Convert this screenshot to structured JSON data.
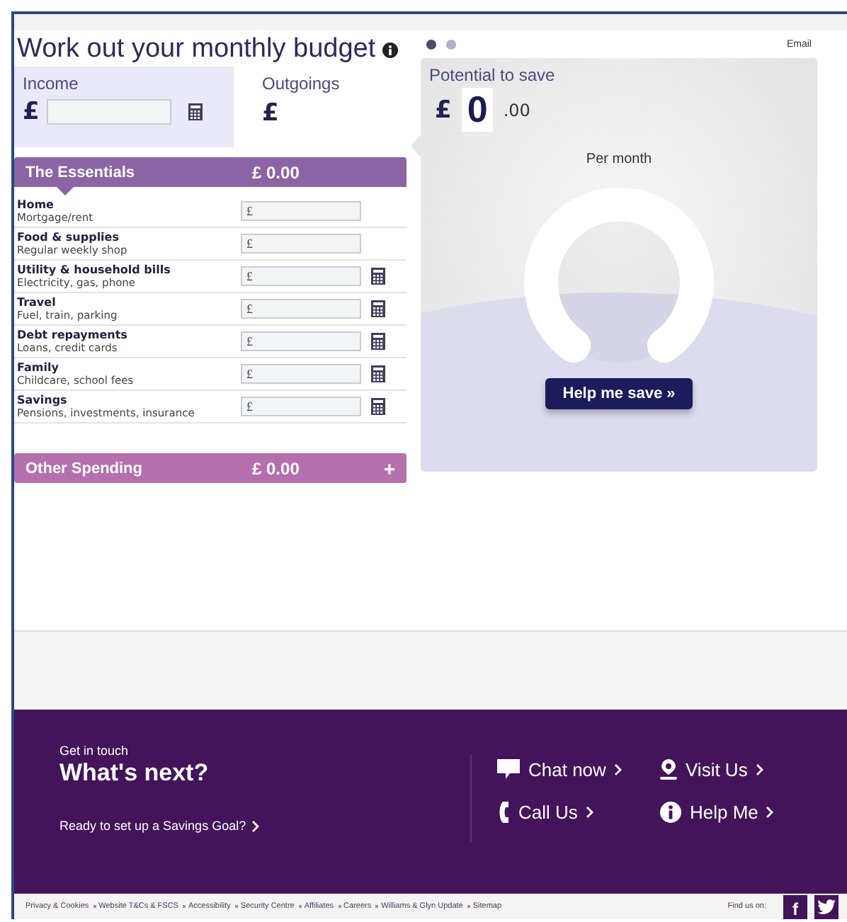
{
  "title": "Work out your monthly budget",
  "carousel": [
    {
      "selected": true
    },
    {
      "selected": false
    }
  ],
  "email_link": "Email",
  "income": {
    "label": "Income",
    "currency": "£"
  },
  "outgoings": {
    "label": "Outgoings",
    "currency": "£"
  },
  "essentials": {
    "title": "The Essentials",
    "total": "£ 0.00"
  },
  "rows": [
    {
      "name": "Home",
      "detail": "Mortgage/rent",
      "currency": "£",
      "calculator": false
    },
    {
      "name": "Food & supplies",
      "detail": "Regular weekly shop",
      "currency": "£",
      "calculator": false
    },
    {
      "name": "Utility & household bills",
      "detail": "Electricity, gas, phone",
      "currency": "£",
      "calculator": true
    },
    {
      "name": "Travel",
      "detail": "Fuel, train, parking",
      "currency": "£",
      "calculator": true
    },
    {
      "name": "Debt repayments",
      "detail": "Loans, credit cards",
      "currency": "£",
      "calculator": true
    },
    {
      "name": "Family",
      "detail": "Childcare, school fees",
      "currency": "£",
      "calculator": true
    },
    {
      "name": "Savings",
      "detail": "Pensions, investments, insurance",
      "currency": "£",
      "calculator": true
    }
  ],
  "other_spending": {
    "title": "Other Spending",
    "total": "£ 0.00",
    "toggle": "+"
  },
  "savings_panel": {
    "label": "Potential to save",
    "currency": "£",
    "amount": "0",
    "pence": ".00",
    "period": "Per month",
    "button": "Help me save »"
  },
  "footer": {
    "eyebrow": "Get in touch",
    "heading": "What's next?",
    "goal_link": "Ready to set up a Savings Goal?",
    "contacts": [
      {
        "kind": "chat",
        "label": "Chat now"
      },
      {
        "kind": "visit",
        "label": "Visit Us"
      },
      {
        "kind": "call",
        "label": "Call Us"
      },
      {
        "kind": "help",
        "label": "Help Me"
      }
    ]
  },
  "bottom_links": [
    "Privacy & Cookies",
    "Website T&Cs & FSCS",
    "Accessibility",
    "Security Centre",
    "Affiliates",
    "Careers",
    "Williams & Glyn Update",
    "Sitemap"
  ],
  "find_us": {
    "label": "Find us on:",
    "social": [
      {
        "kind": "facebook",
        "label": "f"
      },
      {
        "kind": "twitter"
      }
    ]
  }
}
